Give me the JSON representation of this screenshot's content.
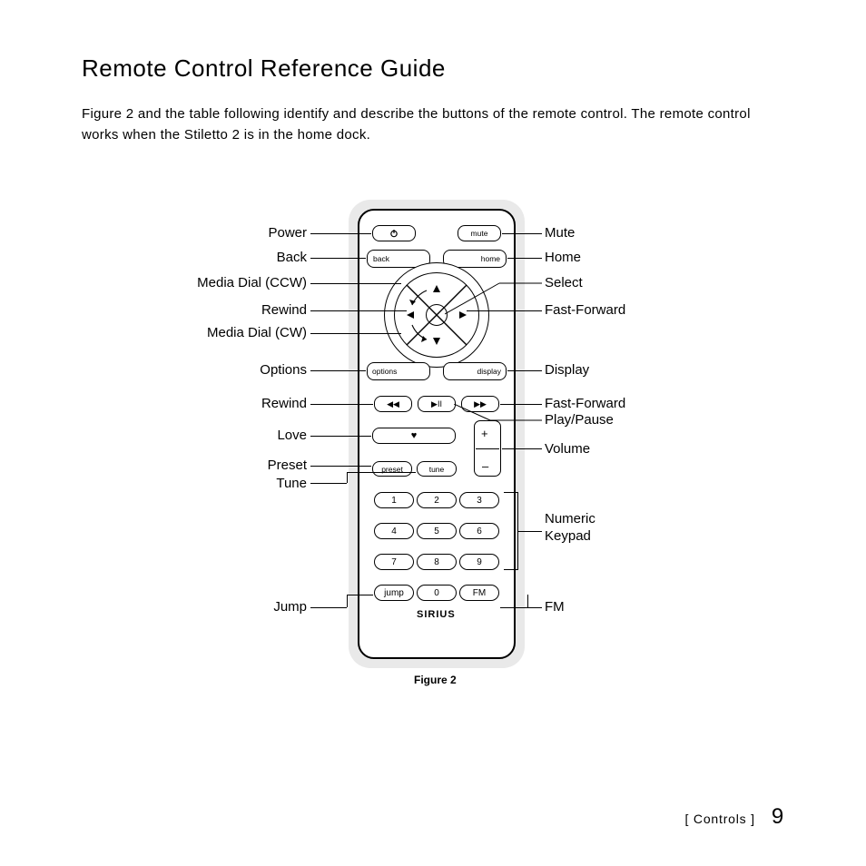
{
  "title": "Remote Control Reference Guide",
  "intro": "Figure 2 and the table following identify and describe the buttons of the remote control. The remote control works when the Stiletto 2 is in the home dock.",
  "figure_caption": "Figure 2",
  "brand": "SIRIUS",
  "footer_section": "Controls",
  "page_number": "9",
  "buttons": {
    "mute": "mute",
    "back": "back",
    "home": "home",
    "options": "options",
    "display": "display",
    "preset": "preset",
    "tune": "tune",
    "jump": "jump",
    "fm": "FM",
    "love": "♥",
    "rw": "◀◀",
    "playpause": "▶II",
    "ff": "▶▶",
    "vol_plus": "+",
    "vol_minus": "–"
  },
  "keypad": [
    "1",
    "2",
    "3",
    "4",
    "5",
    "6",
    "7",
    "8",
    "9",
    "0"
  ],
  "labels": {
    "left": [
      "Power",
      "Back",
      "Media Dial (CCW)",
      "Rewind",
      "Media Dial (CW)",
      "Options",
      "Rewind",
      "Love",
      "Preset",
      "Tune",
      "Jump"
    ],
    "right": [
      "Mute",
      "Home",
      "Select",
      "Fast-Forward",
      "Display",
      "Fast-Forward",
      "Play/Pause",
      "Volume",
      "Numeric",
      "Keypad",
      "FM"
    ]
  }
}
